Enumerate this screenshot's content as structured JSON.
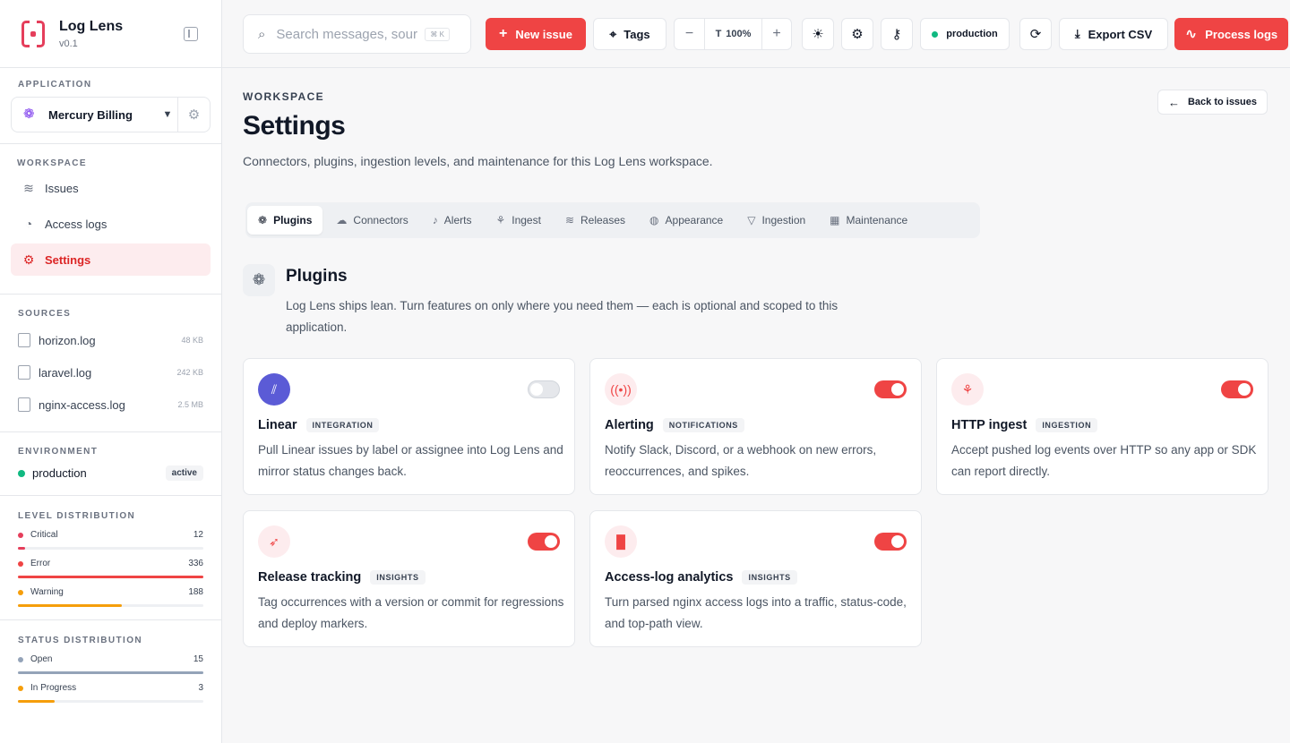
{
  "brand": {
    "name": "Log Lens",
    "version": "v0.1"
  },
  "sidebar": {
    "application_label": "Application",
    "application_name": "Mercury Billing",
    "workspace_label": "Workspace",
    "nav": [
      {
        "label": "Issues",
        "icon": "layers-icon"
      },
      {
        "label": "Access logs",
        "icon": "gauge-icon"
      },
      {
        "label": "Settings",
        "icon": "gear-icon",
        "active": true
      }
    ],
    "sources_label": "Sources",
    "sources": [
      {
        "name": "horizon.log",
        "size": "48 KB"
      },
      {
        "name": "laravel.log",
        "size": "242 KB"
      },
      {
        "name": "nginx-access.log",
        "size": "2.5 MB"
      }
    ],
    "environment_label": "Environment",
    "environment": {
      "name": "production",
      "badge": "active",
      "color": "#10b981"
    },
    "level_label": "Level distribution",
    "levels": [
      {
        "label": "Critical",
        "count": "12",
        "color": "#e53e5b",
        "fill": 0.04
      },
      {
        "label": "Error",
        "count": "336",
        "color": "#ef4444",
        "fill": 1.0
      },
      {
        "label": "Warning",
        "count": "188",
        "color": "#f59e0b",
        "fill": 0.56
      }
    ],
    "status_label": "Status distribution",
    "statuses": [
      {
        "label": "Open",
        "count": "15",
        "color": "#94a3b8",
        "fill": 1.0
      },
      {
        "label": "In Progress",
        "count": "3",
        "color": "#f59e0b",
        "fill": 0.2
      }
    ]
  },
  "toolbar": {
    "search_placeholder": "Search messages, sources",
    "search_shortcut": "⌘ K",
    "new_issue": "New issue",
    "tags": "Tags",
    "zoom_minus": "−",
    "zoom_value": "100%",
    "zoom_plus": "+",
    "environment": "production",
    "export": "Export CSV",
    "process": "Process logs",
    "accent": "#ef4444"
  },
  "page": {
    "breadcrumb": "WORKSPACE",
    "title": "Settings",
    "subtitle": "Connectors, plugins, ingestion levels, and maintenance for this Log Lens workspace.",
    "back": "Back to issues"
  },
  "tabs": [
    {
      "label": "Plugins",
      "icon": "plugins-icon",
      "active": true
    },
    {
      "label": "Connectors",
      "icon": "cloud-icon"
    },
    {
      "label": "Alerts",
      "icon": "bell-icon"
    },
    {
      "label": "Ingest",
      "icon": "webhook-icon"
    },
    {
      "label": "Releases",
      "icon": "layers-icon"
    },
    {
      "label": "Appearance",
      "icon": "palette-icon"
    },
    {
      "label": "Ingestion",
      "icon": "filter-icon"
    },
    {
      "label": "Maintenance",
      "icon": "calendar-icon"
    }
  ],
  "plugins": {
    "title": "Plugins",
    "description": "Log Lens ships lean. Turn features on only where you need them — each is optional and scoped to this application.",
    "cards": [
      {
        "name": "Linear",
        "tag": "INTEGRATION",
        "description": "Pull Linear issues by label or assignee into Log Lens and mirror status changes back.",
        "enabled": false,
        "icon": "linear-icon"
      },
      {
        "name": "Alerting",
        "tag": "NOTIFICATIONS",
        "description": "Notify Slack, Discord, or a webhook on new errors, reoccurrences, and spikes.",
        "enabled": true,
        "icon": "broadcast-icon"
      },
      {
        "name": "HTTP ingest",
        "tag": "INGESTION",
        "description": "Accept pushed log events over HTTP so any app or SDK can report directly.",
        "enabled": true,
        "icon": "webhook-icon"
      },
      {
        "name": "Release tracking",
        "tag": "INSIGHTS",
        "description": "Tag occurrences with a version or commit for regressions and deploy markers.",
        "enabled": true,
        "icon": "rocket-icon"
      },
      {
        "name": "Access-log analytics",
        "tag": "INSIGHTS",
        "description": "Turn parsed nginx access logs into a traffic, status-code, and top-path view.",
        "enabled": true,
        "icon": "bar-chart-icon"
      }
    ]
  }
}
